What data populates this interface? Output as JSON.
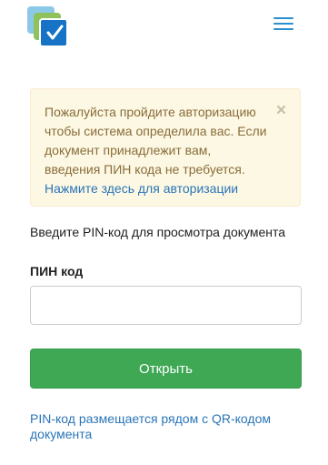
{
  "header": {
    "logo_icon": "checkbox-stack-icon",
    "menu_icon": "hamburger-menu-icon",
    "colors": {
      "logo_back": "#8cc9e8",
      "logo_mid": "#8fc25a",
      "logo_front": "#1673c5",
      "menu": "#2a8ed0"
    }
  },
  "alert": {
    "text": "Пожалуйста пройдите авторизацию чтобы система определила вас. Если документ принадлежит вам, введения ПИН кода не требуется. ",
    "link_text": "Нажмите здесь для авторизации",
    "close_label": "×",
    "colors": {
      "background": "#fcf8e3",
      "text": "#8a6d3b",
      "link": "#2a75b8"
    }
  },
  "form": {
    "instruction": "Введите PIN-код для просмотра документа",
    "pin_label": "ПИН код",
    "pin_value": "",
    "open_button": "Открыть",
    "help_link": "PIN-код размещается рядом с QR-кодом документа",
    "colors": {
      "button": "#3fa854"
    }
  }
}
